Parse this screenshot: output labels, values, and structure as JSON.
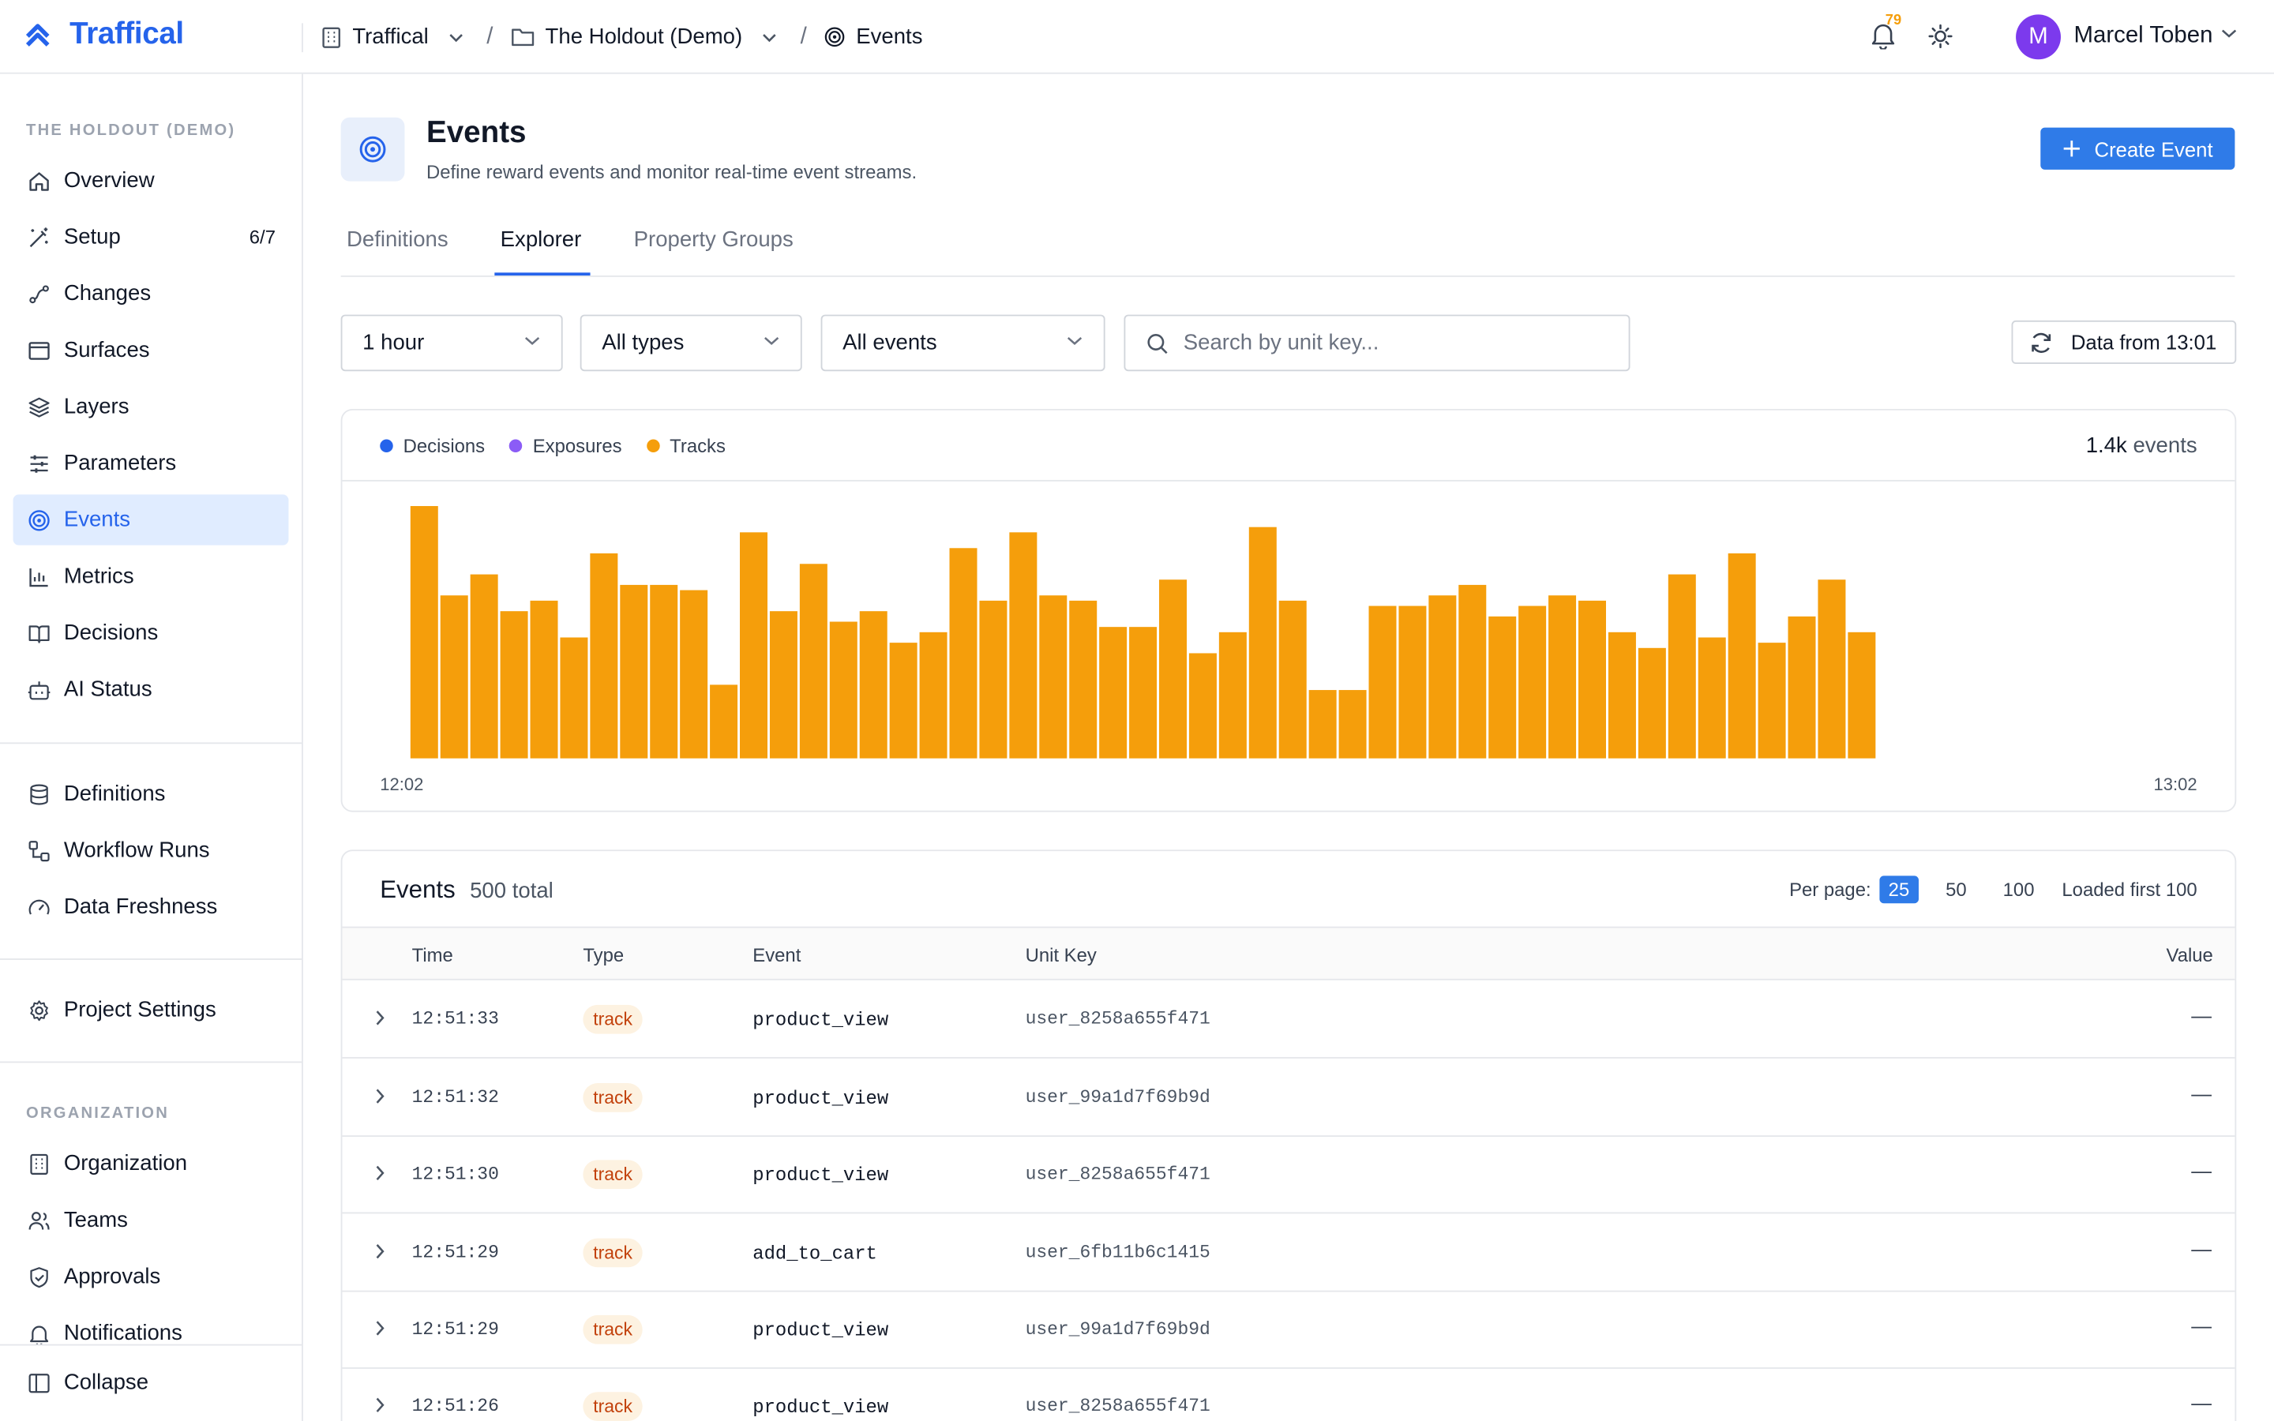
{
  "app": {
    "brand": "Traffical",
    "brand_color": "#2563eb"
  },
  "breadcrumb": {
    "org": "Traffical",
    "project": "The Holdout (Demo)",
    "page": "Events"
  },
  "topbar": {
    "notification_count": "79",
    "user_initial": "M",
    "user_name": "Marcel Toben"
  },
  "sidebar": {
    "project_label": "THE HOLDOUT (DEMO)",
    "items": [
      {
        "label": "Overview",
        "icon": "home-icon"
      },
      {
        "label": "Setup",
        "icon": "wand-icon",
        "count": "6/7"
      },
      {
        "label": "Changes",
        "icon": "changes-icon"
      },
      {
        "label": "Surfaces",
        "icon": "window-icon"
      },
      {
        "label": "Layers",
        "icon": "layers-icon"
      },
      {
        "label": "Parameters",
        "icon": "sliders-icon"
      },
      {
        "label": "Events",
        "icon": "target-icon",
        "active": true
      },
      {
        "label": "Metrics",
        "icon": "bar-chart-icon"
      },
      {
        "label": "Decisions",
        "icon": "book-icon"
      },
      {
        "label": "AI Status",
        "icon": "bot-icon"
      }
    ],
    "items2": [
      {
        "label": "Definitions",
        "icon": "database-icon"
      },
      {
        "label": "Workflow Runs",
        "icon": "workflow-icon"
      },
      {
        "label": "Data Freshness",
        "icon": "gauge-icon"
      }
    ],
    "settings": {
      "label": "Project Settings",
      "icon": "gear-icon"
    },
    "org_label": "ORGANIZATION",
    "org_items": [
      {
        "label": "Organization",
        "icon": "building-icon"
      },
      {
        "label": "Teams",
        "icon": "users-icon"
      },
      {
        "label": "Approvals",
        "icon": "shield-check-icon"
      },
      {
        "label": "Notifications",
        "icon": "bell-icon"
      }
    ],
    "collapse": "Collapse"
  },
  "page": {
    "title": "Events",
    "subtitle": "Define reward events and monitor real-time event streams.",
    "create_button": "Create Event",
    "tabs": [
      "Definitions",
      "Explorer",
      "Property Groups"
    ],
    "active_tab": "Explorer"
  },
  "filters": {
    "time_range": "1 hour",
    "type": "All types",
    "event": "All events",
    "search_placeholder": "Search by unit key...",
    "refresh_label": "Data from 13:01"
  },
  "chart_data": {
    "type": "bar",
    "legend": [
      {
        "name": "Decisions",
        "color": "#2563eb"
      },
      {
        "name": "Exposures",
        "color": "#8b5cf6"
      },
      {
        "name": "Tracks",
        "color": "#f59e0b"
      }
    ],
    "total_count": "1.4k",
    "total_unit": "events",
    "x_start": "12:02",
    "x_end": "13:02",
    "bucket_count": 60,
    "series": [
      {
        "name": "Tracks",
        "color": "#f59e0b",
        "values": [
          48,
          31,
          35,
          28,
          30,
          23,
          39,
          33,
          33,
          32,
          14,
          43,
          28,
          37,
          26,
          28,
          22,
          24,
          40,
          30,
          43,
          31,
          30,
          25,
          25,
          34,
          20,
          24,
          44,
          30,
          13,
          13,
          29,
          29,
          31,
          33,
          27,
          29,
          31,
          30,
          24,
          21,
          35,
          23,
          39,
          22,
          27,
          34,
          24,
          0,
          0,
          0,
          0,
          0,
          0,
          0,
          0,
          0,
          0,
          0
        ]
      }
    ]
  },
  "table": {
    "title": "Events",
    "total": "500 total",
    "per_page_label": "Per page:",
    "per_page_options": [
      "25",
      "50",
      "100"
    ],
    "per_page_selected": "25",
    "loaded": "Loaded first 100",
    "columns": [
      "Time",
      "Type",
      "Event",
      "Unit Key",
      "Value"
    ],
    "rows": [
      {
        "time": "12:51:33",
        "type": "track",
        "event": "product_view",
        "unit": "user_8258a655f471",
        "value": "—"
      },
      {
        "time": "12:51:32",
        "type": "track",
        "event": "product_view",
        "unit": "user_99a1d7f69b9d",
        "value": "—"
      },
      {
        "time": "12:51:30",
        "type": "track",
        "event": "product_view",
        "unit": "user_8258a655f471",
        "value": "—"
      },
      {
        "time": "12:51:29",
        "type": "track",
        "event": "add_to_cart",
        "unit": "user_6fb11b6c1415",
        "value": "—"
      },
      {
        "time": "12:51:29",
        "type": "track",
        "event": "product_view",
        "unit": "user_99a1d7f69b9d",
        "value": "—"
      },
      {
        "time": "12:51:26",
        "type": "track",
        "event": "product_view",
        "unit": "user_8258a655f471",
        "value": "—"
      }
    ]
  }
}
